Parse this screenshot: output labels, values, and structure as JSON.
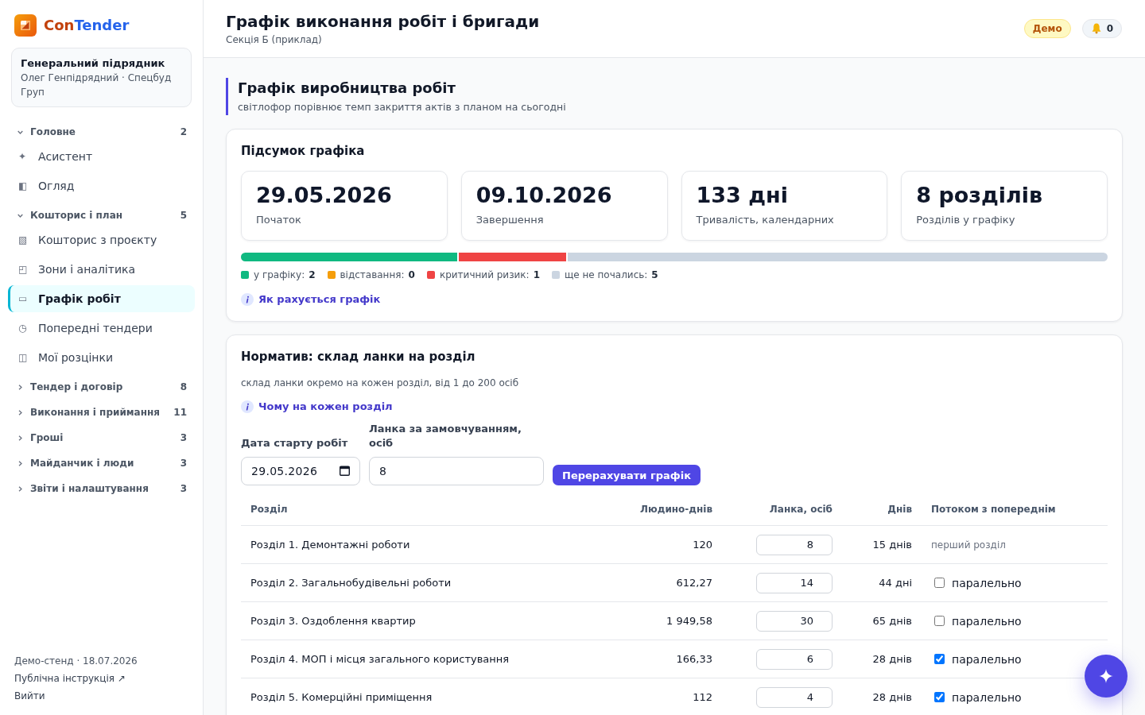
{
  "sidebar": {
    "brand": {
      "parts": [
        "Con",
        "Tender"
      ]
    },
    "account": {
      "role": "Генеральний підрядник",
      "user": "Олег Генпідрядний · Спецбуд Груп"
    },
    "groups": [
      {
        "label": "Головне",
        "count": "2",
        "expanded": true,
        "items": [
          {
            "icon": "✦",
            "label": "Асистент",
            "selected": false
          },
          {
            "icon": "◧",
            "label": "Огляд",
            "selected": false
          }
        ]
      },
      {
        "label": "Кошторис і план",
        "count": "5",
        "expanded": true,
        "items": [
          {
            "icon": "▧",
            "label": "Кошторис з проєкту",
            "selected": false
          },
          {
            "icon": "◰",
            "label": "Зони і аналітика",
            "selected": false
          },
          {
            "icon": "▭",
            "label": "Графік робіт",
            "selected": true
          },
          {
            "icon": "◷",
            "label": "Попередні тендери",
            "selected": false
          },
          {
            "icon": "◫",
            "label": "Мої розцінки",
            "selected": false
          }
        ]
      },
      {
        "label": "Тендер і договір",
        "count": "8",
        "expanded": false
      },
      {
        "label": "Виконання і приймання",
        "count": "11",
        "expanded": false
      },
      {
        "label": "Гроші",
        "count": "3",
        "expanded": false
      },
      {
        "label": "Майданчик і люди",
        "count": "3",
        "expanded": false
      },
      {
        "label": "Звіти і налаштування",
        "count": "3",
        "expanded": false
      }
    ],
    "footer": {
      "stand": "Демо-стенд · 18.07.2026",
      "links": [
        "Публічна інструкція ↗",
        "Вийти"
      ]
    }
  },
  "header": {
    "title": "Графік виконання робіт і бригади",
    "subtitle": "Секція Б (приклад)",
    "badge": "Демо",
    "notifications": "0"
  },
  "section": {
    "title": "Графік виробництва робіт",
    "subtitle": "світлофор порівнює темп закриття актів з планом на сьогодні"
  },
  "summary": {
    "title": "Підсумок графіка",
    "stats": [
      {
        "value": "29.05.2026",
        "label": "Початок"
      },
      {
        "value": "09.10.2026",
        "label": "Завершення"
      },
      {
        "value": "133 дні",
        "label": "Тривалість, календарних"
      },
      {
        "value": "8 розділів",
        "label": "Розділів у графіку"
      }
    ],
    "progress": [
      {
        "label": "у графіку:",
        "count": "2",
        "color": "#10b981"
      },
      {
        "label": "відставання:",
        "count": "0",
        "color": "#f59e0b"
      },
      {
        "label": "критичний ризик:",
        "count": "1",
        "color": "#ef4444"
      },
      {
        "label": "ще не почались:",
        "count": "5",
        "color": "#cbd5e1"
      }
    ],
    "help_link": "Як рахується графік"
  },
  "crew_norm": {
    "title": "Норматив: склад ланки на розділ",
    "note": "склад ланки окремо на кожен розділ, від 1 до 200 осіб",
    "help_link": "Чому на кожен розділ",
    "start_date": {
      "label": "Дата старту робіт",
      "value": "29.05.2026"
    },
    "default_crew": {
      "label": "Ланка за замовчуванням, осіб",
      "value": "8"
    },
    "recalc_button": "Перерахувати графік",
    "table": {
      "columns": [
        "Розділ",
        "Людино-днів",
        "Ланка, осіб",
        "Днів",
        "Потоком з попереднім"
      ],
      "rows": [
        {
          "section": "Розділ 1. Демонтажні роботи",
          "man_days": "120",
          "crew": "8",
          "days": "15 днів",
          "flow": {
            "kind": "note",
            "text": "перший розділ"
          }
        },
        {
          "section": "Розділ 2. Загальнобудівельні роботи",
          "man_days": "612,27",
          "crew": "14",
          "days": "44 дні",
          "flow": {
            "kind": "toggle",
            "checked": false,
            "label": "паралельно"
          }
        },
        {
          "section": "Розділ 3. Оздоблення квартир",
          "man_days": "1 949,58",
          "crew": "30",
          "days": "65 днів",
          "flow": {
            "kind": "toggle",
            "checked": false,
            "label": "паралельно"
          }
        },
        {
          "section": "Розділ 4. МОП і місця загального користування",
          "man_days": "166,33",
          "crew": "6",
          "days": "28 днів",
          "flow": {
            "kind": "toggle",
            "checked": true,
            "label": "паралельно"
          }
        },
        {
          "section": "Розділ 5. Комерційні приміщення",
          "man_days": "112",
          "crew": "4",
          "days": "28 днів",
          "flow": {
            "kind": "toggle",
            "checked": true,
            "label": "паралельно"
          }
        }
      ]
    }
  }
}
